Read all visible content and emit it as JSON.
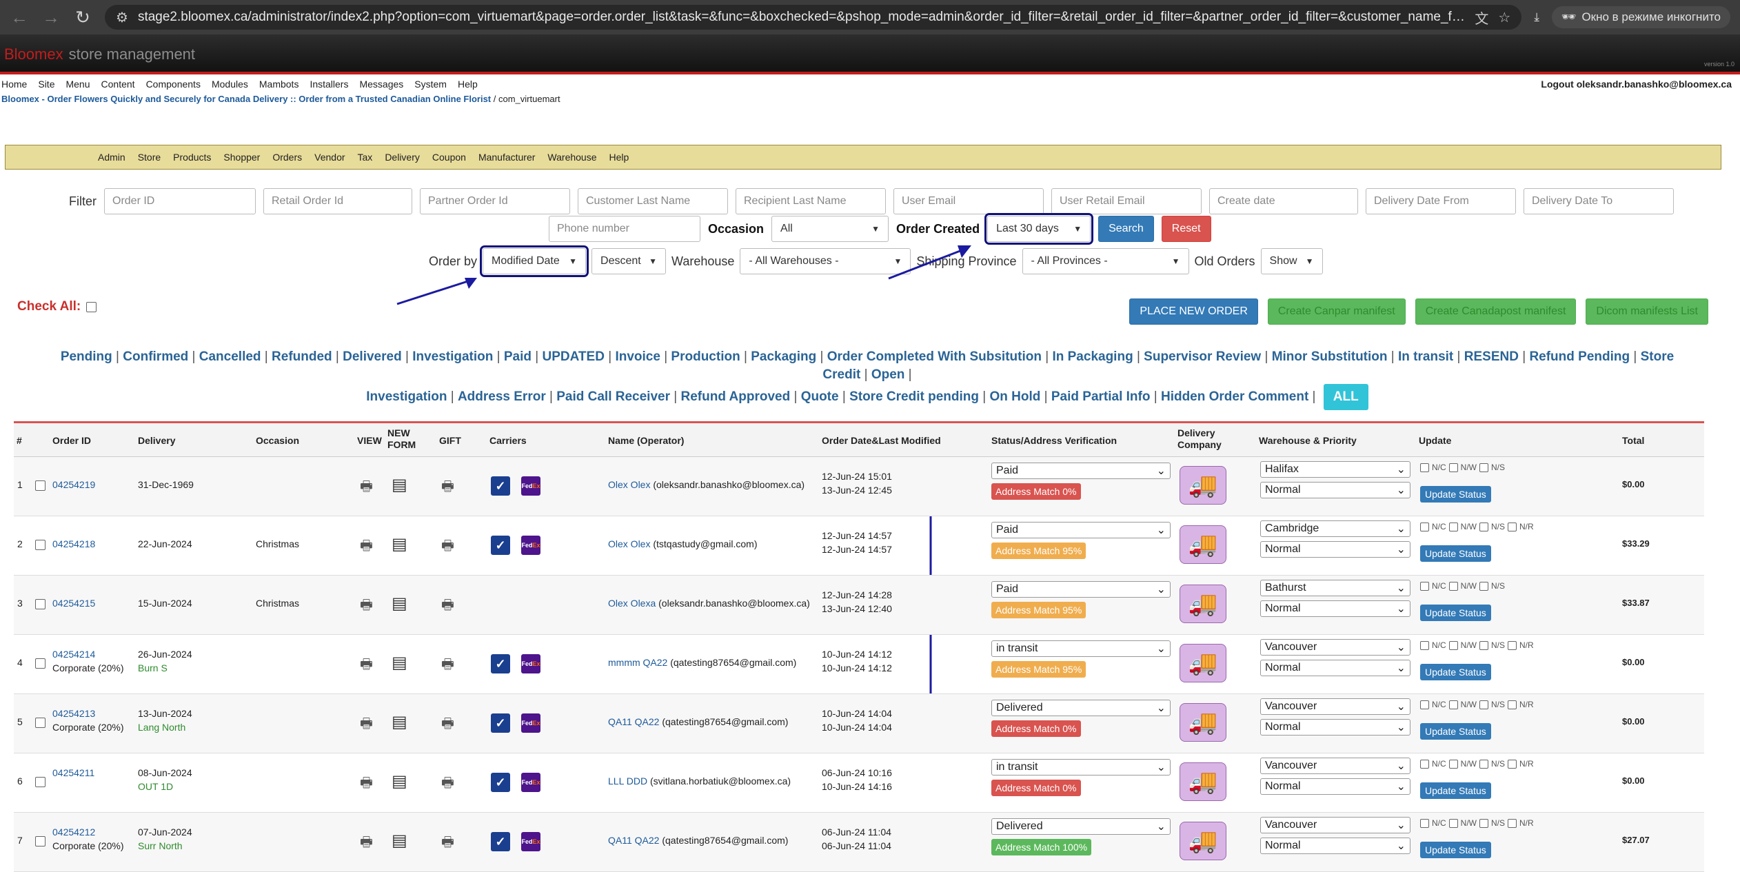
{
  "browser": {
    "url": "stage2.bloomex.ca/administrator/index2.php?option=com_virtuemart&page=order.order_list&task=&func=&boxchecked=&pshop_mode=admin&order_id_filter=&retail_order_id_filter=&partner_order_id_filter=&customer_name_filter=&recipien...",
    "incognito_label": "Окно в режиме инкогнито"
  },
  "header": {
    "brand": "Bloomex",
    "brand_suffix": "store management",
    "version": "version 1.0"
  },
  "topmenu": {
    "items": [
      "Home",
      "Site",
      "Menu",
      "Content",
      "Components",
      "Modules",
      "Mambots",
      "Installers",
      "Messages",
      "System",
      "Help"
    ],
    "logout": "Logout oleksandr.banashko@bloomex.ca"
  },
  "breadcrumb": {
    "link": "Bloomex - Order Flowers Quickly and Securely for Canada Delivery :: Order from a Trusted Canadian Online Florist",
    "rest": "/ com_virtuemart"
  },
  "vmmenu": [
    "Admin",
    "Store",
    "Products",
    "Shopper",
    "Orders",
    "Vendor",
    "Tax",
    "Delivery",
    "Coupon",
    "Manufacturer",
    "Warehouse",
    "Help"
  ],
  "filters": {
    "label": "Filter",
    "placeholders": [
      "Order ID",
      "Retail Order Id",
      "Partner Order Id",
      "Customer Last Name",
      "Recipient Last Name",
      "User Email",
      "User Retail Email",
      "Create date",
      "Delivery Date From",
      "Delivery Date To"
    ],
    "phone_placeholder": "Phone number",
    "occasion_label": "Occasion",
    "occasion_value": "All",
    "order_created_label": "Order Created",
    "order_created_value": "Last 30 days",
    "search": "Search",
    "reset": "Reset",
    "order_by_label": "Order by",
    "order_by_value": "Modified Date",
    "direction_value": "Descent",
    "warehouse_label": "Warehouse",
    "warehouse_value": "- All Warehouses -",
    "province_label": "Shipping Province",
    "province_value": "- All Provinces -",
    "old_orders_label": "Old Orders",
    "old_orders_value": "Show"
  },
  "check_all": "Check All:",
  "actions": [
    "PLACE NEW ORDER",
    "Create Canpar manifest",
    "Create Canadapost manifest",
    "Dicom manifests List"
  ],
  "status_links_line1": [
    "Pending",
    "Confirmed",
    "Cancelled",
    "Refunded",
    "Delivered",
    "Investigation",
    "Paid",
    "UPDATED",
    "Invoice",
    "Production",
    "Packaging",
    "Order Completed With Subsitution",
    "In Packaging",
    "Supervisor Review",
    "Minor Substitution",
    "In transit",
    "RESEND",
    "Refund Pending",
    "Store Credit",
    "Open"
  ],
  "status_links_line2": [
    "Investigation",
    "Address Error",
    "Paid Call Receiver",
    "Refund Approved",
    "Quote",
    "Store Credit pending",
    "On Hold",
    "Paid Partial Info",
    "Hidden Order Comment"
  ],
  "all_button": "ALL",
  "table": {
    "headers": {
      "num": "#",
      "order_id": "Order ID",
      "delivery": "Delivery",
      "occasion": "Occasion",
      "view": "VIEW",
      "new_form": "NEW FORM",
      "gift": "GIFT",
      "carriers": "Carriers",
      "name": "Name (Operator)",
      "dates": "Order Date&Last Modified",
      "status": "Status/Address Verification",
      "company": "Delivery Company",
      "warehouse": "Warehouse & Priority",
      "update": "Update",
      "total": "Total"
    },
    "rows": [
      {
        "n": "1",
        "id": "04254219",
        "delivery": "31-Dec-1969",
        "delivery2": "",
        "occasion": "",
        "name": "Olex Olex",
        "email": "(oleksandr.banashko@bloomex.ca)",
        "d1": "12-Jun-24 15:01",
        "d2": "13-Jun-24 12:45",
        "status": "Paid",
        "match": "Address Match 0%",
        "match_color": "red",
        "warehouse": "Halifax",
        "priority": "Normal",
        "nr": false,
        "total": "$0.00",
        "carriers": true
      },
      {
        "n": "2",
        "id": "04254218",
        "delivery": "22-Jun-2024",
        "delivery2": "",
        "occasion": "Christmas",
        "name": "Olex Olex",
        "email": "(tstqastudy@gmail.com)",
        "d1": "12-Jun-24 14:57",
        "d2": "12-Jun-24 14:57",
        "status": "Paid",
        "match": "Address Match 95%",
        "match_color": "orange",
        "warehouse": "Cambridge",
        "priority": "Normal",
        "nr": true,
        "total": "$33.29",
        "carriers": true
      },
      {
        "n": "3",
        "id": "04254215",
        "delivery": "15-Jun-2024",
        "delivery2": "",
        "occasion": "Christmas",
        "name": "Olex Olexa",
        "email": "(oleksandr.banashko@bloomex.ca)",
        "d1": "12-Jun-24 14:28",
        "d2": "13-Jun-24 12:40",
        "status": "Paid",
        "match": "Address Match 95%",
        "match_color": "orange",
        "warehouse": "Bathurst",
        "priority": "Normal",
        "nr": false,
        "total": "$33.87",
        "carriers": false
      },
      {
        "n": "4",
        "id": "04254214",
        "delivery": "26-Jun-2024",
        "delivery2": "Burn S",
        "occasion": "Corporate (20%)",
        "name": "mmmm QA22",
        "email": "(qatesting87654@gmail.com)",
        "d1": "10-Jun-24 14:12",
        "d2": "10-Jun-24 14:12",
        "status": "in transit",
        "match": "Address Match 95%",
        "match_color": "orange",
        "warehouse": "Vancouver",
        "priority": "Normal",
        "nr": true,
        "total": "$0.00",
        "carriers": true
      },
      {
        "n": "5",
        "id": "04254213",
        "delivery": "13-Jun-2024",
        "delivery2": "Lang North",
        "occasion": "Corporate (20%)",
        "name": "QA11 QA22",
        "email": "(qatesting87654@gmail.com)",
        "d1": "10-Jun-24 14:04",
        "d2": "10-Jun-24 14:04",
        "status": "Delivered",
        "match": "Address Match 0%",
        "match_color": "red",
        "warehouse": "Vancouver",
        "priority": "Normal",
        "nr": true,
        "total": "$0.00",
        "carriers": true
      },
      {
        "n": "6",
        "id": "04254211",
        "delivery": "08-Jun-2024",
        "delivery2": "OUT 1D",
        "occasion": "",
        "name": "LLL DDD",
        "email": "(svitlana.horbatiuk@bloomex.ca)",
        "d1": "06-Jun-24 10:16",
        "d2": "10-Jun-24 14:16",
        "status": "in transit",
        "match": "Address Match 0%",
        "match_color": "red",
        "warehouse": "Vancouver",
        "priority": "Normal",
        "nr": true,
        "total": "$0.00",
        "carriers": true
      },
      {
        "n": "7",
        "id": "04254212",
        "delivery": "07-Jun-2024",
        "delivery2": "Surr North",
        "occasion": "Corporate (20%)",
        "name": "QA11 QA22",
        "email": "(qatesting87654@gmail.com)",
        "d1": "06-Jun-24 11:04",
        "d2": "06-Jun-24 11:04",
        "status": "Delivered",
        "match": "Address Match 100%",
        "match_color": "green",
        "warehouse": "Vancouver",
        "priority": "Normal",
        "nr": true,
        "total": "$27.07",
        "carriers": true
      }
    ],
    "update_button": "Update Status",
    "flags": [
      "N/C",
      "N/W",
      "N/S",
      "N/R"
    ]
  }
}
